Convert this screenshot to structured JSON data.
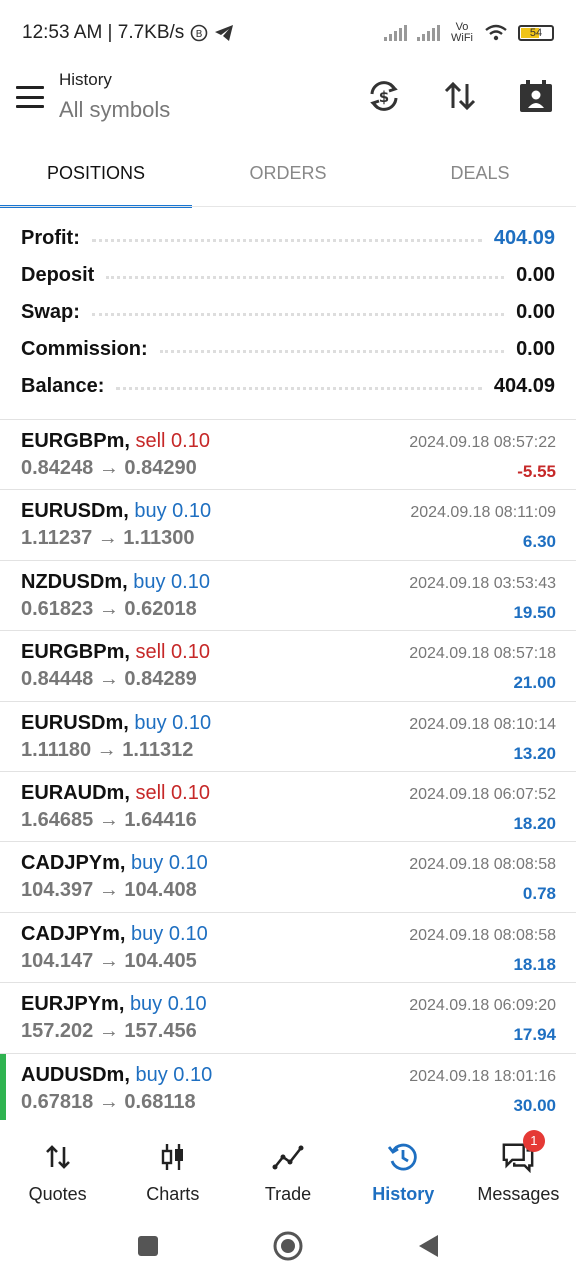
{
  "status": {
    "time": "12:53 AM | 7.7KB/s",
    "network": "Vo WiFi",
    "battery": "54"
  },
  "header": {
    "title": "History",
    "subtitle": "All symbols"
  },
  "tabs": [
    {
      "label": "POSITIONS",
      "active": true
    },
    {
      "label": "ORDERS",
      "active": false
    },
    {
      "label": "DEALS",
      "active": false
    }
  ],
  "summary": [
    {
      "label": "Profit:",
      "value": "404.09"
    },
    {
      "label": "Deposit",
      "value": "0.00"
    },
    {
      "label": "Swap:",
      "value": "0.00"
    },
    {
      "label": "Commission:",
      "value": "0.00"
    },
    {
      "label": "Balance:",
      "value": "404.09"
    }
  ],
  "deals": [
    {
      "symbol": "EURGBPm,",
      "type": "sell 0.10",
      "prices": "0.84248 → 0.84290",
      "time": "2024.09.18 08:57:22",
      "profit": "-5.55"
    },
    {
      "symbol": "EURUSDm,",
      "type": "buy 0.10",
      "prices": "1.11237 → 1.11300",
      "time": "2024.09.18 08:11:09",
      "profit": "6.30"
    },
    {
      "symbol": "NZDUSDm,",
      "type": "buy 0.10",
      "prices": "0.61823 → 0.62018",
      "time": "2024.09.18 03:53:43",
      "profit": "19.50"
    },
    {
      "symbol": "EURGBPm,",
      "type": "sell 0.10",
      "prices": "0.84448 → 0.84289",
      "time": "2024.09.18 08:57:18",
      "profit": "21.00"
    },
    {
      "symbol": "EURUSDm,",
      "type": "buy 0.10",
      "prices": "1.11180 → 1.11312",
      "time": "2024.09.18 08:10:14",
      "profit": "13.20"
    },
    {
      "symbol": "EURAUDm,",
      "type": "sell 0.10",
      "prices": "1.64685 → 1.64416",
      "time": "2024.09.18 06:07:52",
      "profit": "18.20"
    },
    {
      "symbol": "CADJPYm,",
      "type": "buy 0.10",
      "prices": "104.397 → 104.408",
      "time": "2024.09.18 08:08:58",
      "profit": "0.78"
    },
    {
      "symbol": "CADJPYm,",
      "type": "buy 0.10",
      "prices": "104.147 → 104.405",
      "time": "2024.09.18 08:08:58",
      "profit": "18.18"
    },
    {
      "symbol": "EURJPYm,",
      "type": "buy 0.10",
      "prices": "157.202 → 157.456",
      "time": "2024.09.18 06:09:20",
      "profit": "17.94"
    },
    {
      "symbol": "AUDUSDm,",
      "type": "buy 0.10",
      "prices": "0.67818 → 0.68118",
      "time": "2024.09.18 18:01:16",
      "profit": "30.00"
    }
  ],
  "bottom_nav": [
    {
      "label": "Quotes",
      "icon": "quotes-icon"
    },
    {
      "label": "Charts",
      "icon": "charts-icon"
    },
    {
      "label": "Trade",
      "icon": "trade-icon"
    },
    {
      "label": "History",
      "icon": "history-icon",
      "active": true
    },
    {
      "label": "Messages",
      "icon": "messages-icon",
      "badge": "1"
    }
  ],
  "colors": {
    "accent": "#1e6fc1",
    "sell": "#c62828",
    "selected_marker": "#2fb350",
    "badge": "#e53935"
  }
}
